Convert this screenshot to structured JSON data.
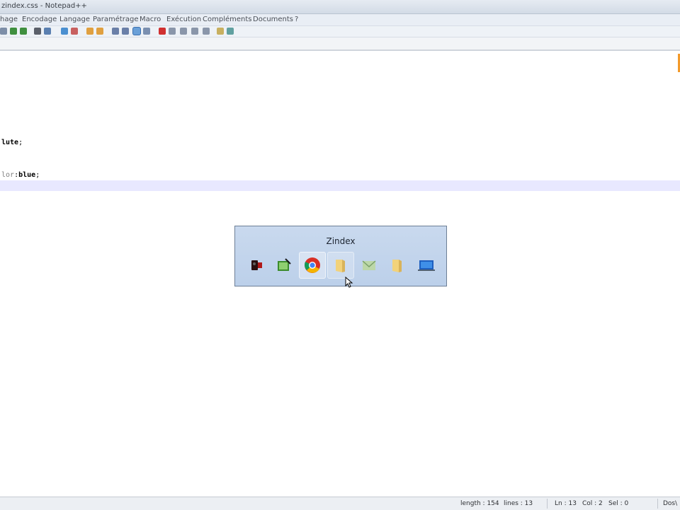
{
  "window": {
    "title": "zindex.css - Notepad++"
  },
  "menu": [
    "hage",
    "Encodage",
    "Langage",
    "Paramétrage",
    "Macro",
    "Exécution",
    "Compléments",
    "Documents",
    "?"
  ],
  "editor": {
    "lines": [
      {
        "prefix": "",
        "keyword": "",
        "value": "lute",
        "suffix": ";"
      },
      {
        "prefix": "lor",
        "keyword": ":",
        "value": "blue",
        "suffix": ";"
      }
    ]
  },
  "taskbar_popup": {
    "title": "Zindex",
    "icons": [
      "video-camera-icon",
      "image-editor-icon",
      "chrome-icon",
      "folder-icon",
      "mail-icon",
      "folder-icon",
      "laptop-icon"
    ]
  },
  "status": {
    "length": "length : 154",
    "lines": "lines : 13",
    "ln": "Ln : 13",
    "col": "Col : 2",
    "sel": "Sel : 0",
    "eol": "Dos\\"
  }
}
